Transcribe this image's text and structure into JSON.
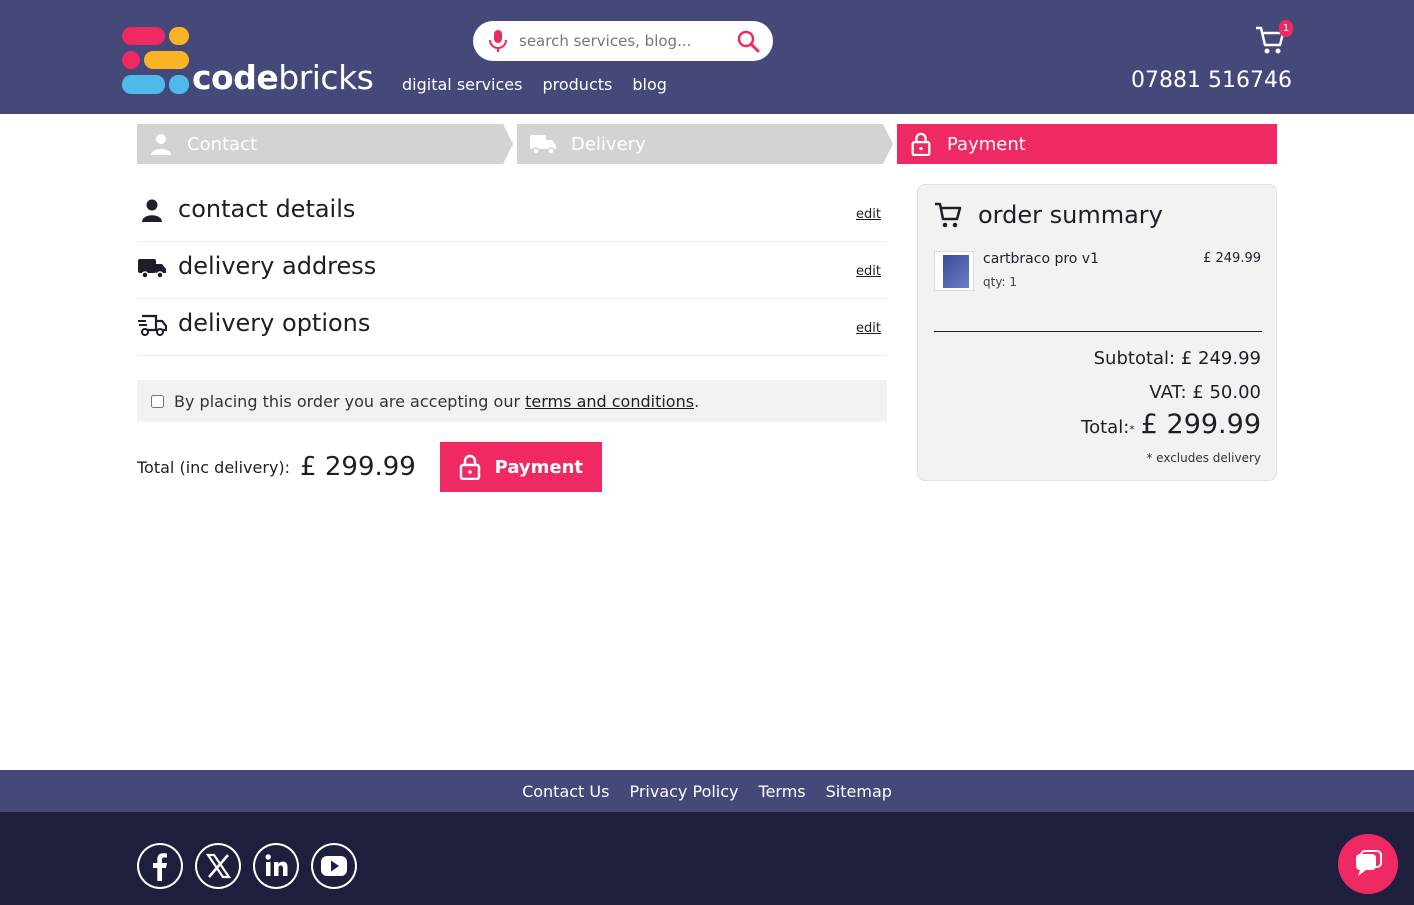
{
  "header": {
    "logo_text_bold": "code",
    "logo_text_light": "bricks",
    "search_placeholder": "search services, blog...",
    "nav": [
      "digital services",
      "products",
      "blog"
    ],
    "cart_count": "1",
    "phone": "07881 516746"
  },
  "steps": {
    "contact": "Contact",
    "delivery": "Delivery",
    "payment": "Payment"
  },
  "sections": [
    {
      "title": "contact details",
      "edit": "edit"
    },
    {
      "title": "delivery address",
      "edit": "edit"
    },
    {
      "title": "delivery options",
      "edit": "edit"
    }
  ],
  "terms": {
    "text": "By placing this order you are accepting our ",
    "link": "terms and conditions",
    "end": "."
  },
  "total": {
    "label": "Total (inc delivery):",
    "amount": "£ 299.99",
    "button": "Payment"
  },
  "summary": {
    "title": "order summary",
    "item_name": "cartbraco pro v1",
    "item_qty": "qty: 1",
    "item_price": "£ 249.99",
    "subtotal": "Subtotal: £ 249.99",
    "vat": "VAT: £ 50.00",
    "total_label": "Total:",
    "total_star": "*",
    "total_value": "£ 299.99",
    "excludes": "* excludes delivery"
  },
  "footer": {
    "links": [
      "Contact Us",
      "Privacy Policy",
      "Terms",
      "Sitemap"
    ],
    "social": [
      "facebook-icon",
      "x-icon",
      "linkedin-icon",
      "youtube-icon"
    ]
  },
  "colors": {
    "header_bg": "#45497a",
    "accent": "#ef2a62",
    "footer_bg": "#1e1f3c",
    "step_inactive": "#d3d3d3"
  }
}
